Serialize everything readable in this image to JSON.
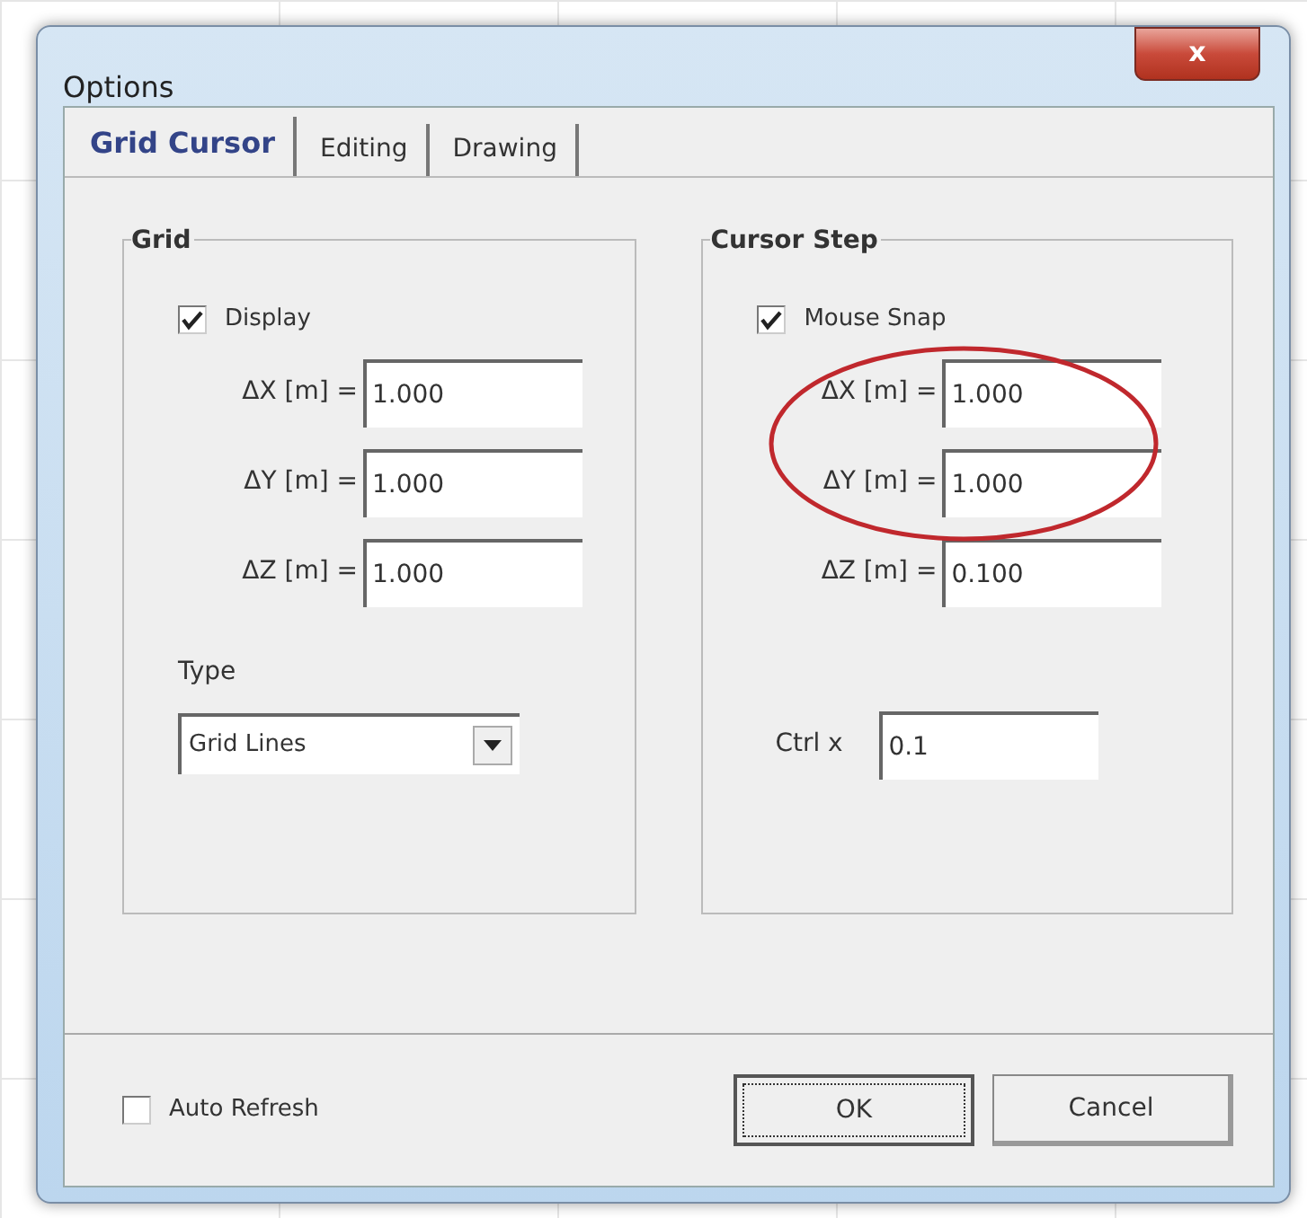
{
  "window": {
    "title": "Options",
    "close": "x"
  },
  "tabs": [
    {
      "label": "Grid Cursor",
      "selected": true
    },
    {
      "label": "Editing",
      "selected": false
    },
    {
      "label": "Drawing",
      "selected": false
    }
  ],
  "grid": {
    "title": "Grid",
    "display": {
      "label": "Display",
      "checked": true
    },
    "fields": [
      {
        "label": "ΔX [m] =",
        "value": "1.000"
      },
      {
        "label": "ΔY [m] =",
        "value": "1.000"
      },
      {
        "label": "ΔZ [m] =",
        "value": "1.000"
      }
    ],
    "type_label": "Type",
    "type_value": "Grid Lines"
  },
  "cursor_step": {
    "title": "Cursor Step",
    "mouse_snap": {
      "label": "Mouse Snap",
      "checked": true
    },
    "fields": [
      {
        "label": "ΔX [m] =",
        "value": "1.000",
        "circled": true
      },
      {
        "label": "ΔY [m] =",
        "value": "1.000",
        "circled": true
      },
      {
        "label": "ΔZ [m] =",
        "value": "0.100",
        "circled": false
      }
    ],
    "ctrl_label": "Ctrl x",
    "ctrl_value": "0.1"
  },
  "auto_refresh": {
    "label": "Auto Refresh",
    "checked": false
  },
  "buttons": [
    {
      "label": "OK",
      "focused": true
    },
    {
      "label": "Cancel",
      "focused": false
    }
  ]
}
